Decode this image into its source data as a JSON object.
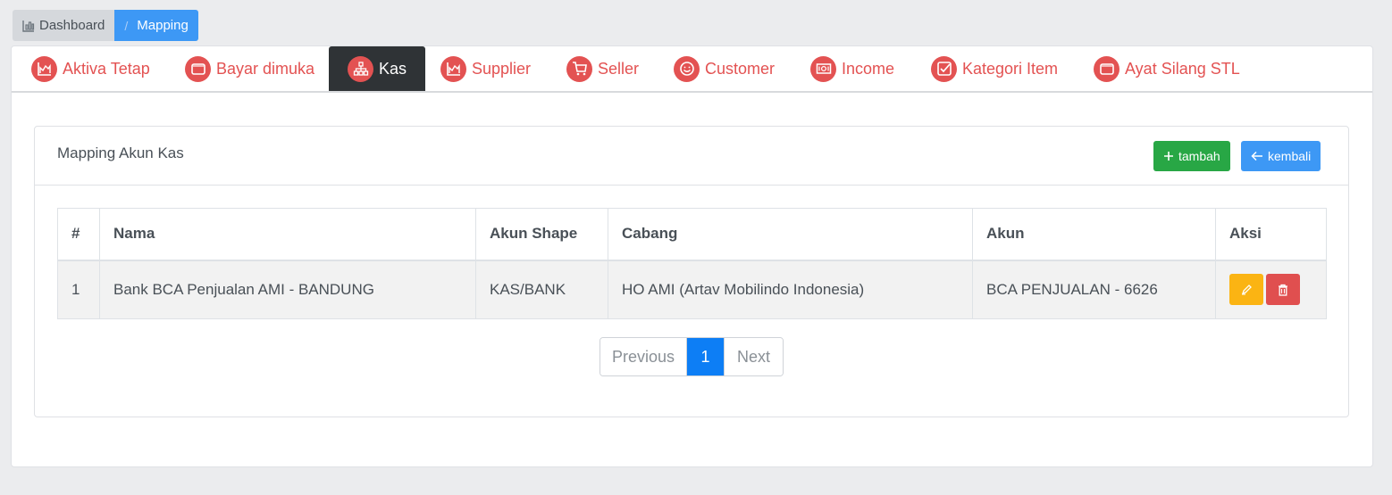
{
  "breadcrumb": {
    "home": "Dashboard",
    "separator": "/",
    "current": "Mapping"
  },
  "tabs": [
    {
      "label": "Aktiva Tetap",
      "icon": "chart-icon",
      "active": false
    },
    {
      "label": "Bayar dimuka",
      "icon": "wallet-icon",
      "active": false
    },
    {
      "label": "Kas",
      "icon": "sitemap-icon",
      "active": true
    },
    {
      "label": "Supplier",
      "icon": "chart-icon",
      "active": false
    },
    {
      "label": "Seller",
      "icon": "cart-icon",
      "active": false
    },
    {
      "label": "Customer",
      "icon": "smile-icon",
      "active": false
    },
    {
      "label": "Income",
      "icon": "money-icon",
      "active": false
    },
    {
      "label": "Kategori Item",
      "icon": "checkbox-icon",
      "active": false
    },
    {
      "label": "Ayat Silang STL",
      "icon": "wallet-icon",
      "active": false
    }
  ],
  "panel": {
    "title": "Mapping Akun Kas",
    "add_label": "tambah",
    "back_label": "kembali"
  },
  "table": {
    "headers": [
      "#",
      "Nama",
      "Akun Shape",
      "Cabang",
      "Akun",
      "Aksi"
    ],
    "rows": [
      [
        "1",
        "Bank BCA Penjualan AMI - BANDUNG",
        "KAS/BANK",
        "HO AMI (Artav Mobilindo Indonesia)",
        "BCA PENJUALAN - 6626"
      ]
    ]
  },
  "pagination": {
    "previous": "Previous",
    "current": "1",
    "next": "Next"
  },
  "colors": {
    "accent_red": "#e35252",
    "primary_blue": "#3d98f5",
    "success_green": "#28a745",
    "warning_yellow": "#fbb413",
    "danger_red": "#e04f4f",
    "active_tab_bg": "#2f3336"
  }
}
